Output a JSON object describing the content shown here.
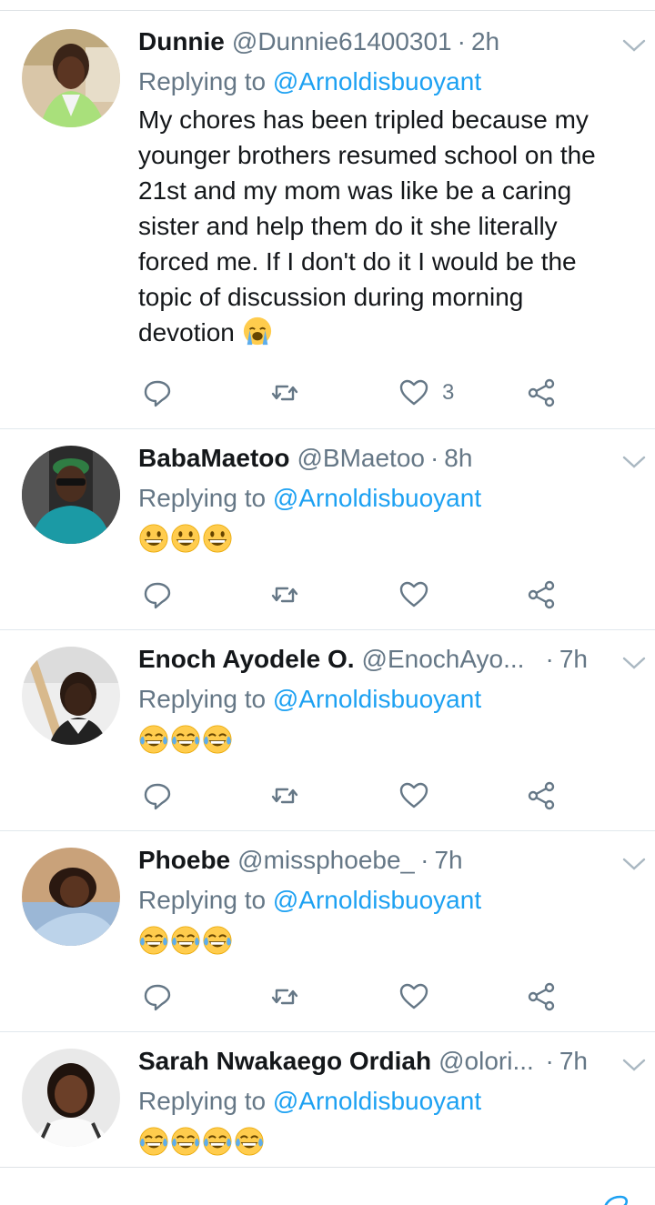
{
  "colors": {
    "accent": "#1da1f2",
    "secondary": "#657786",
    "primary_text": "#14171a"
  },
  "tweets": [
    {
      "name": "Dunnie",
      "handle": "@Dunnie61400301",
      "time": "2h",
      "replying_prefix": "Replying to",
      "replying_to": "@Arnoldisbuoyant",
      "text": "My chores has been tripled because my\nyounger brothers resumed school on the\n21st and my mom was like be a caring\nsister and help them do it she literally\nforced me. If I don't do it I would be the\ntopic of discussion during morning\ndevotion",
      "text_emoji": "loudly-crying-face",
      "likes": "3"
    },
    {
      "name": "BabaMaetoo",
      "handle": "@BMaetoo",
      "time": "8h",
      "replying_prefix": "Replying to",
      "replying_to": "@Arnoldisbuoyant",
      "emoji": "grinning-face-with-big-eyes",
      "emoji_count": 3
    },
    {
      "name": "Enoch Ayodele O.",
      "handle": "@EnochAyo...",
      "time": "7h",
      "replying_prefix": "Replying to",
      "replying_to": "@Arnoldisbuoyant",
      "emoji": "face-with-tears-of-joy",
      "emoji_count": 3
    },
    {
      "name": "Phoebe",
      "handle": "@missphoebe_",
      "time": "7h",
      "replying_prefix": "Replying to",
      "replying_to": "@Arnoldisbuoyant",
      "emoji": "face-with-tears-of-joy",
      "emoji_count": 3
    },
    {
      "name": "Sarah Nwakaego Ordiah",
      "handle": "@olori...",
      "time": "7h",
      "replying_prefix": "Replying to",
      "replying_to": "@Arnoldisbuoyant",
      "emoji": "face-with-tears-of-joy",
      "emoji_count": 4
    }
  ],
  "icons": {
    "reply": "reply-icon",
    "retweet": "retweet-icon",
    "like": "heart-icon",
    "share": "share-icon",
    "menu": "chevron-down-icon",
    "compose": "compose-icon"
  }
}
